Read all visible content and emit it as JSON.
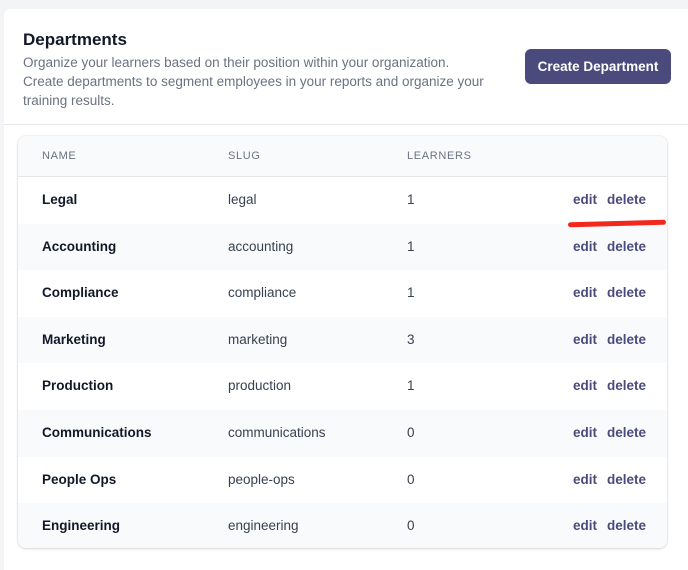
{
  "header": {
    "title": "Departments",
    "description": "Organize your learners based on their position within your organization. Create departments to segment employees in your reports and organize your training results.",
    "create_button_label": "Create Department"
  },
  "table": {
    "columns": {
      "name": "NAME",
      "slug": "SLUG",
      "learners": "LEARNERS"
    },
    "edit_label": "edit",
    "delete_label": "delete",
    "rows": [
      {
        "name": "Legal",
        "slug": "legal",
        "learners": "1"
      },
      {
        "name": "Accounting",
        "slug": "accounting",
        "learners": "1"
      },
      {
        "name": "Compliance",
        "slug": "compliance",
        "learners": "1"
      },
      {
        "name": "Marketing",
        "slug": "marketing",
        "learners": "3"
      },
      {
        "name": "Production",
        "slug": "production",
        "learners": "1"
      },
      {
        "name": "Communications",
        "slug": "communications",
        "learners": "0"
      },
      {
        "name": "People Ops",
        "slug": "people-ops",
        "learners": "0"
      },
      {
        "name": "Engineering",
        "slug": "engineering",
        "learners": "0"
      }
    ]
  },
  "colors": {
    "accent": "#4a4a7c",
    "annotation": "#f2271d"
  }
}
